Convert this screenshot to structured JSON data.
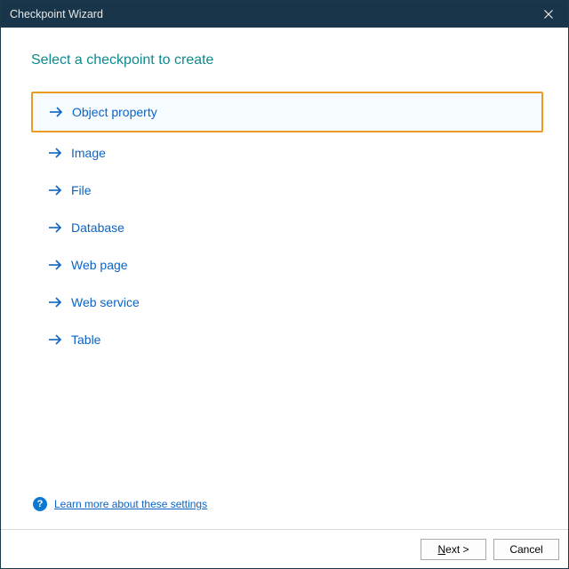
{
  "titlebar": {
    "title": "Checkpoint Wizard"
  },
  "heading": "Select a checkpoint to create",
  "options": [
    {
      "label": "Object property",
      "selected": true
    },
    {
      "label": "Image",
      "selected": false
    },
    {
      "label": "File",
      "selected": false
    },
    {
      "label": "Database",
      "selected": false
    },
    {
      "label": "Web page",
      "selected": false
    },
    {
      "label": "Web service",
      "selected": false
    },
    {
      "label": "Table",
      "selected": false
    }
  ],
  "learn_link": "Learn more about these settings",
  "buttons": {
    "next_prefix": "N",
    "next_suffix": "ext >",
    "cancel": "Cancel"
  },
  "colors": {
    "titlebar_bg": "#193549",
    "accent_link": "#0b63c4",
    "heading": "#0d8a8f",
    "highlight_border": "#ec9b22"
  }
}
